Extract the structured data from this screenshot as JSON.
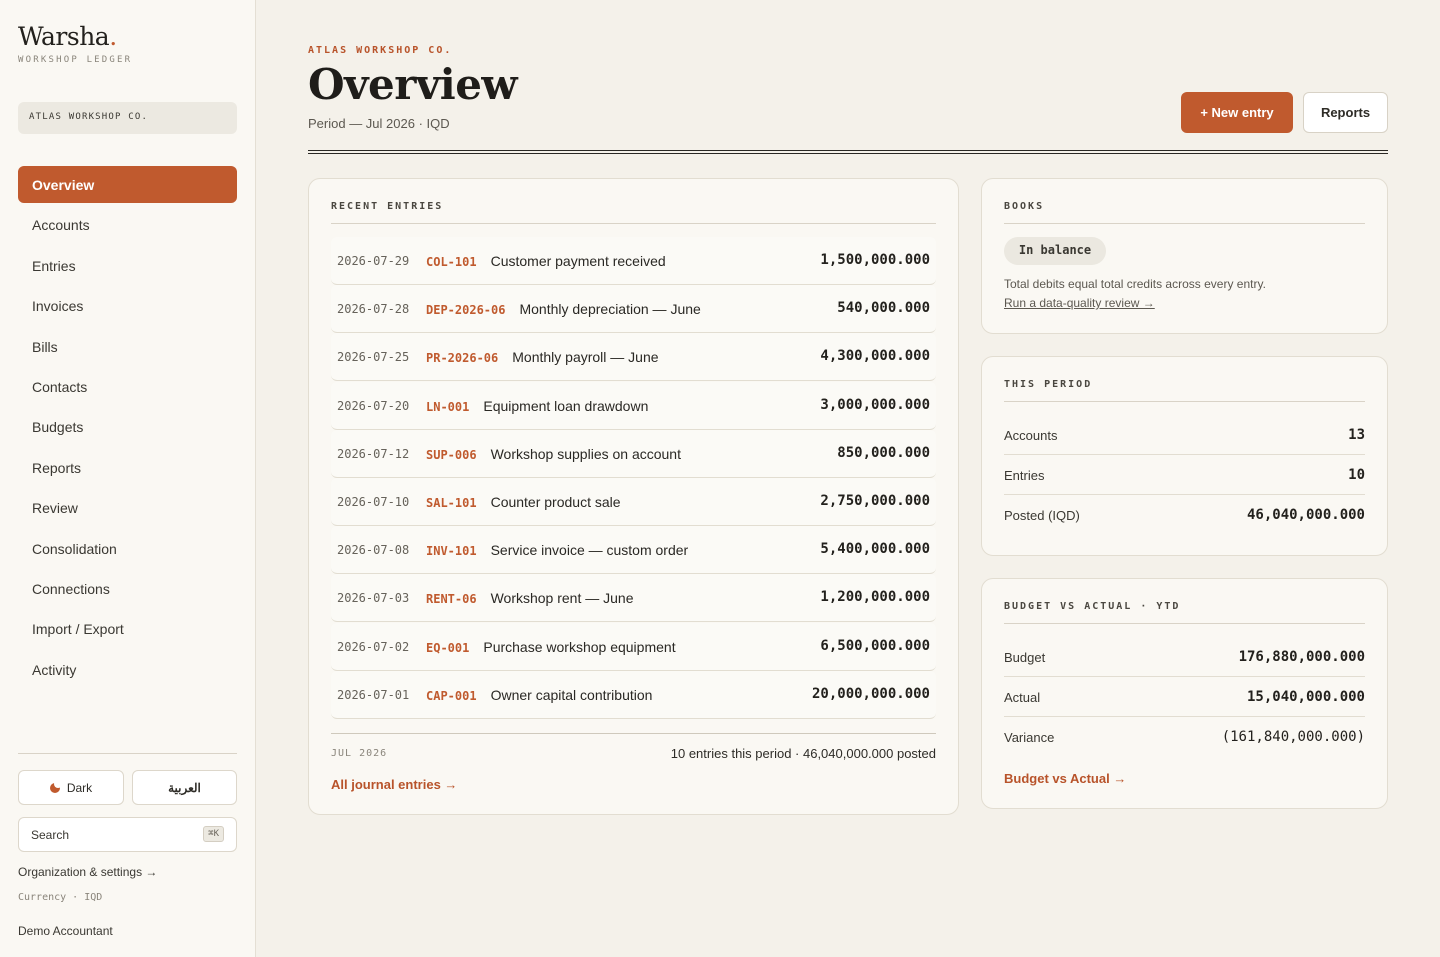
{
  "brand": {
    "name": "Warsha",
    "dot": ".",
    "subtitle": "WORKSHOP LEDGER"
  },
  "org": {
    "name": "ATLAS WORKSHOP CO."
  },
  "nav": [
    {
      "label": "Overview",
      "active": true
    },
    {
      "label": "Accounts"
    },
    {
      "label": "Entries"
    },
    {
      "label": "Invoices"
    },
    {
      "label": "Bills"
    },
    {
      "label": "Contacts"
    },
    {
      "label": "Budgets"
    },
    {
      "label": "Reports"
    },
    {
      "label": "Review"
    },
    {
      "label": "Consolidation"
    },
    {
      "label": "Connections"
    },
    {
      "label": "Import / Export"
    },
    {
      "label": "Activity"
    }
  ],
  "sidebar_footer": {
    "dark_label": "Dark",
    "lang_label": "العربية",
    "search_label": "Search",
    "search_kbd": "⌘K",
    "org_settings": "Organization & settings →",
    "currency": "Currency · IQD",
    "user": "Demo Accountant"
  },
  "header": {
    "eyebrow": "ATLAS WORKSHOP CO.",
    "title": "Overview",
    "period": "Period — Jul 2026 · IQD",
    "new_entry": "+ New entry",
    "reports": "Reports"
  },
  "recent": {
    "label": "RECENT ENTRIES",
    "entries": [
      {
        "date": "2026-07-29",
        "ref": "COL-101",
        "desc": "Customer payment received",
        "amount": "1,500,000.000"
      },
      {
        "date": "2026-07-28",
        "ref": "DEP-2026-06",
        "desc": "Monthly depreciation — June",
        "amount": "540,000.000"
      },
      {
        "date": "2026-07-25",
        "ref": "PR-2026-06",
        "desc": "Monthly payroll — June",
        "amount": "4,300,000.000"
      },
      {
        "date": "2026-07-20",
        "ref": "LN-001",
        "desc": "Equipment loan drawdown",
        "amount": "3,000,000.000"
      },
      {
        "date": "2026-07-12",
        "ref": "SUP-006",
        "desc": "Workshop supplies on account",
        "amount": "850,000.000"
      },
      {
        "date": "2026-07-10",
        "ref": "SAL-101",
        "desc": "Counter product sale",
        "amount": "2,750,000.000"
      },
      {
        "date": "2026-07-08",
        "ref": "INV-101",
        "desc": "Service invoice — custom order",
        "amount": "5,400,000.000"
      },
      {
        "date": "2026-07-03",
        "ref": "RENT-06",
        "desc": "Workshop rent — June",
        "amount": "1,200,000.000"
      },
      {
        "date": "2026-07-02",
        "ref": "EQ-001",
        "desc": "Purchase workshop equipment",
        "amount": "6,500,000.000"
      },
      {
        "date": "2026-07-01",
        "ref": "CAP-001",
        "desc": "Owner capital contribution",
        "amount": "20,000,000.000"
      }
    ],
    "footer_month": "JUL 2026",
    "footer_summary": "10 entries this period · 46,040,000.000 posted",
    "all_link": "All journal entries →"
  },
  "books": {
    "label": "BOOKS",
    "badge": "In balance",
    "text": "Total debits equal total credits across every entry.",
    "link": "Run a data-quality review →"
  },
  "this_period": {
    "label": "THIS PERIOD",
    "rows": [
      {
        "label": "Accounts",
        "value": "13"
      },
      {
        "label": "Entries",
        "value": "10"
      },
      {
        "label": "Posted (IQD)",
        "value": "46,040,000.000"
      }
    ]
  },
  "budget": {
    "label": "BUDGET VS ACTUAL · YTD",
    "rows": [
      {
        "label": "Budget",
        "value": "176,880,000.000"
      },
      {
        "label": "Actual",
        "value": "15,040,000.000"
      },
      {
        "label": "Variance",
        "value": "(161,840,000.000)"
      }
    ],
    "link": "Budget vs Actual →"
  },
  "colors": {
    "accent": "#c05a2e",
    "background": "#f4f1ea",
    "card": "#faf8f3"
  }
}
